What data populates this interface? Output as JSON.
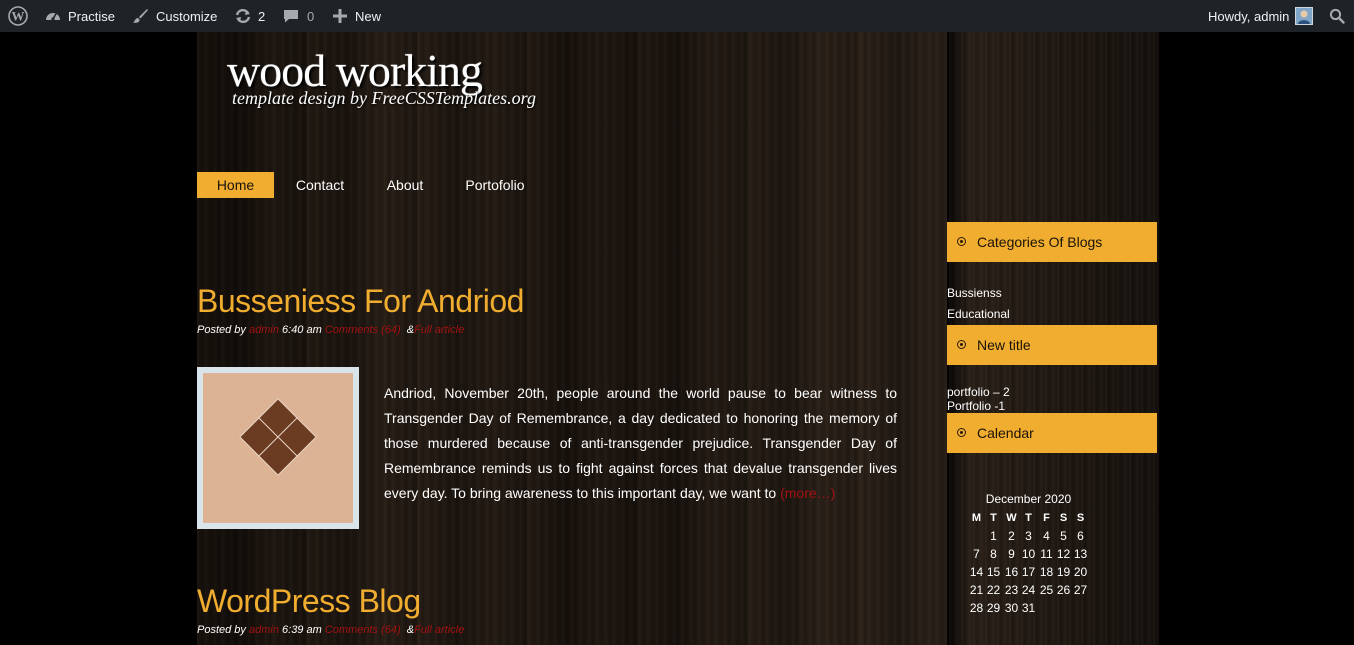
{
  "admin_bar": {
    "site_name": "Practise",
    "customize": "Customize",
    "updates_count": "2",
    "comments_count": "0",
    "new_label": "New",
    "greeting": "Howdy, admin"
  },
  "header": {
    "title": "wood working",
    "tagline": "template design by FreeCSSTemplates.org"
  },
  "nav": {
    "items": [
      {
        "label": "Home",
        "active": true
      },
      {
        "label": "Contact",
        "active": false
      },
      {
        "label": "About",
        "active": false
      },
      {
        "label": "Portofolio",
        "active": false
      }
    ]
  },
  "posts": [
    {
      "title": "Busseniess For Andriod",
      "posted_by_label": "Posted by",
      "author": "admin",
      "time": "6:40 am",
      "comments": "Comments (64)",
      "amp": "&",
      "full_article": "Full article",
      "excerpt": "Andriod, November 20th, people around the world pause to bear witness to Transgender Day of Remembrance, a day dedicated to honoring the memory of those murdered because of anti-transgender prejudice. Transgender Day of Remembrance reminds us to fight against forces that devalue transgender lives every day. To bring awareness to this important day, we want to",
      "more": "(more…)"
    },
    {
      "title": "WordPress Blog",
      "posted_by_label": "Posted by",
      "author": "admin",
      "time": "6:39 am",
      "comments": "Comments (64)",
      "amp": "&",
      "full_article": "Full article"
    }
  ],
  "sidebar": {
    "widgets": [
      {
        "title": "Categories Of Blogs",
        "links": [
          "Bussienss",
          "Educational"
        ]
      },
      {
        "title": "New title",
        "links": [
          "portfolio – 2",
          "Portfolio -1"
        ]
      },
      {
        "title": "Calendar"
      }
    ],
    "calendar": {
      "caption": "December 2020",
      "weekdays": [
        "M",
        "T",
        "W",
        "T",
        "F",
        "S",
        "S"
      ],
      "weeks": [
        [
          "",
          "1",
          "2",
          "3",
          "4",
          "5",
          "6"
        ],
        [
          "7",
          "8",
          "9",
          "10",
          "11",
          "12",
          "13"
        ],
        [
          "14",
          "15",
          "16",
          "17",
          "18",
          "19",
          "20"
        ],
        [
          "21",
          "22",
          "23",
          "24",
          "25",
          "26",
          "27"
        ],
        [
          "28",
          "29",
          "30",
          "31",
          "",
          "",
          ""
        ]
      ]
    }
  },
  "colors": {
    "accent": "#f0ad2f",
    "link_red": "#a31212",
    "admin_bar": "#1d2327"
  }
}
